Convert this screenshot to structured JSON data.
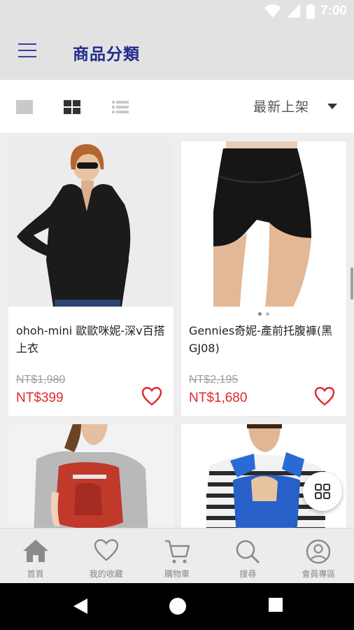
{
  "status_bar": {
    "time": "7:00",
    "icons": [
      "wifi-icon",
      "signal-icon",
      "battery-icon"
    ]
  },
  "app_bar": {
    "title": "商品分類",
    "menu_icon": "hamburger-menu-icon"
  },
  "toolbar": {
    "view_modes": [
      "single-view-icon",
      "grid-view-icon",
      "list-view-icon"
    ],
    "sort_label": "最新上架"
  },
  "products": [
    {
      "name": "ohoh-mini 歐歐咪妮-深v百搭上衣",
      "original_price": "NT$1,980",
      "price": "NT$399"
    },
    {
      "name": "Gennies奇妮-產前托腹褲(黑GJ08)",
      "original_price": "NT$2,195",
      "price": "NT$1,680"
    },
    {
      "name": "",
      "original_price": "",
      "price": ""
    },
    {
      "name": "",
      "original_price": "",
      "price": ""
    }
  ],
  "bottom_nav": [
    {
      "label": "首頁",
      "icon": "home-icon"
    },
    {
      "label": "我的收藏",
      "icon": "heart-icon"
    },
    {
      "label": "購物車",
      "icon": "cart-icon"
    },
    {
      "label": "搜尋",
      "icon": "search-icon"
    },
    {
      "label": "會員專區",
      "icon": "account-icon"
    }
  ],
  "colors": {
    "accent": "#1f2d8a",
    "price": "#e0282f",
    "app_bar": "#e2e2e2"
  }
}
